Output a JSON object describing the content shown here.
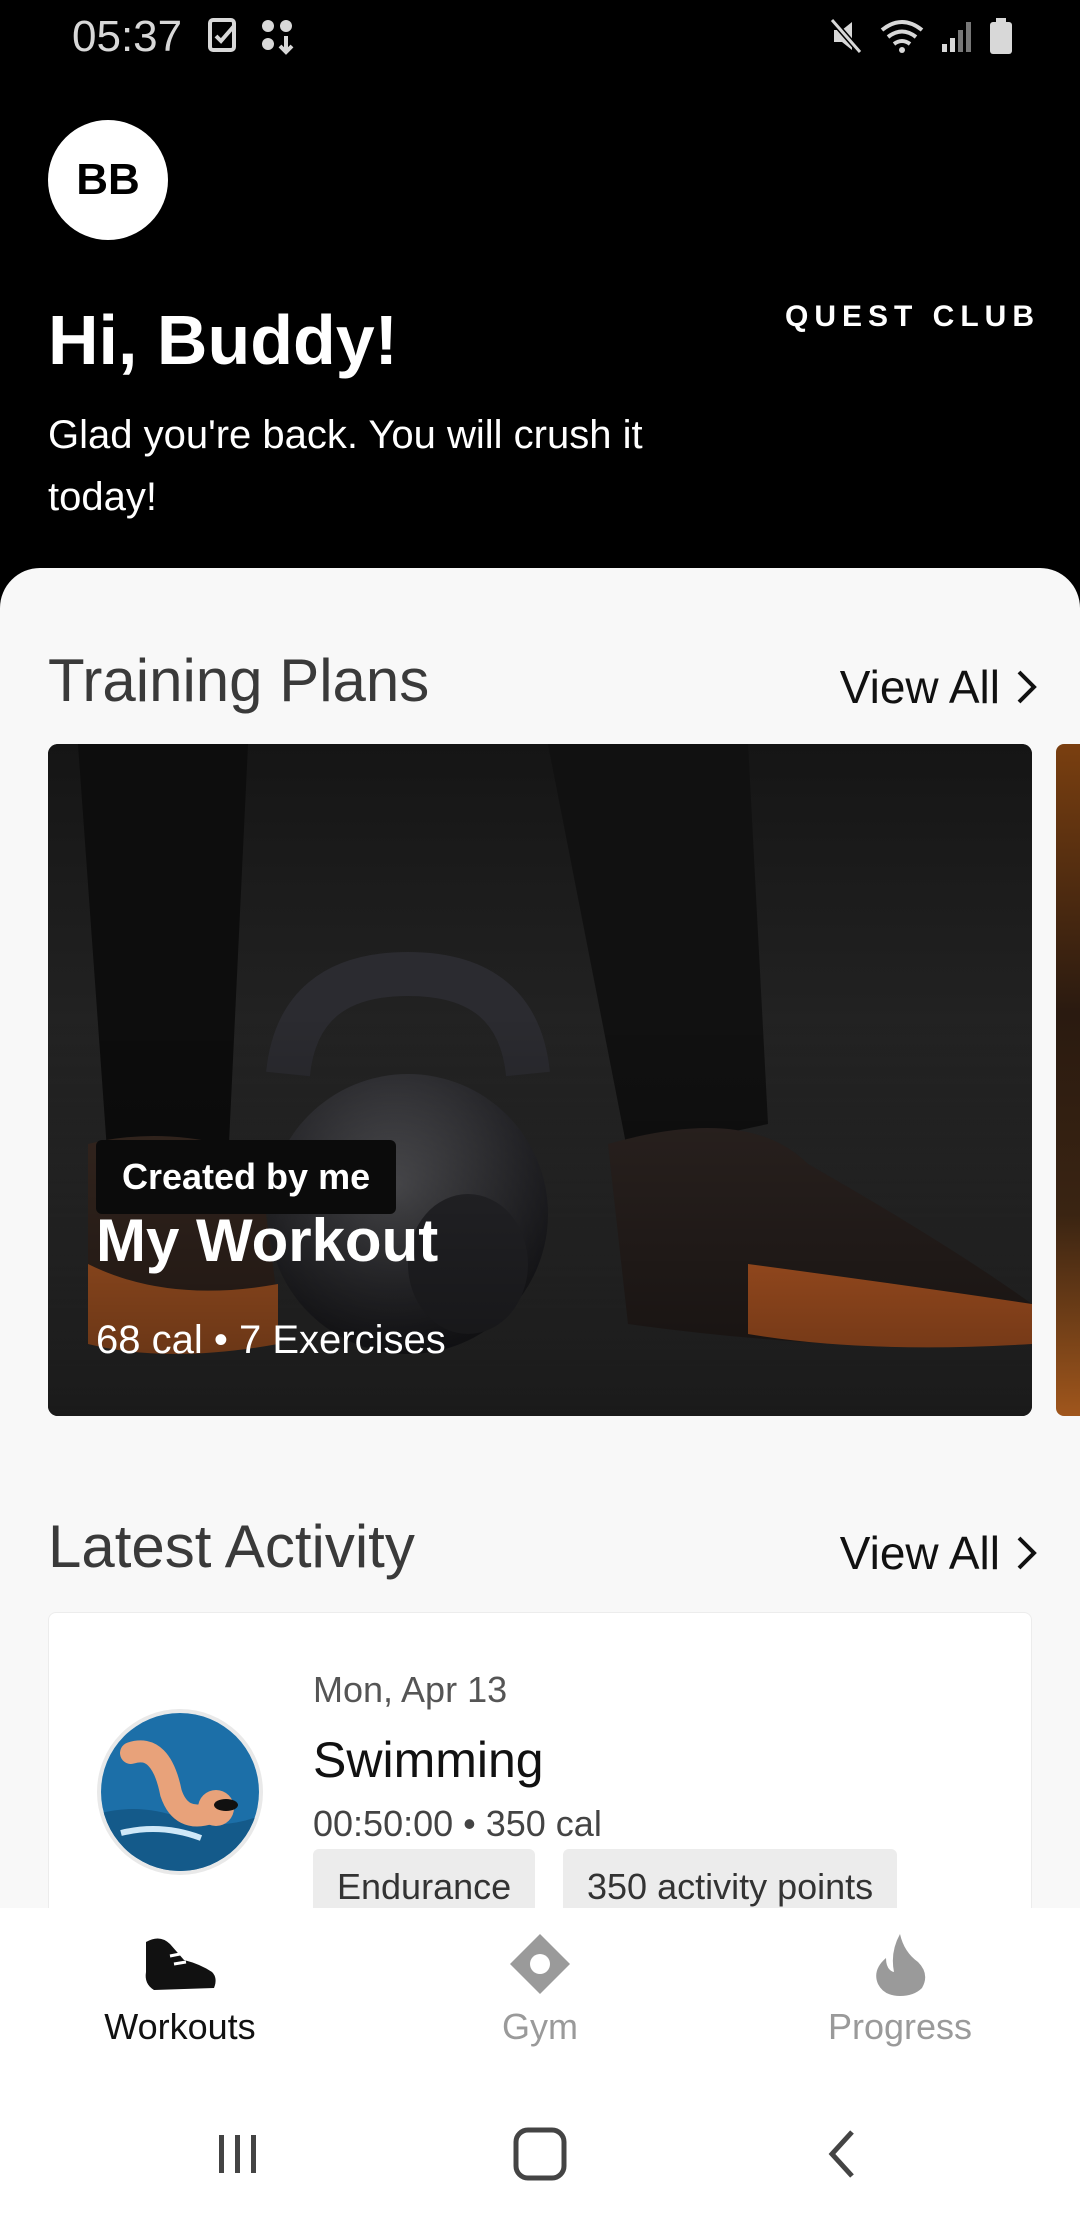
{
  "status_bar": {
    "time": "05:37",
    "left_icons": [
      "task-check-icon",
      "app-grid-icon"
    ],
    "right_icons": [
      "mute-icon",
      "wifi-icon",
      "signal-icon",
      "battery-icon"
    ]
  },
  "header": {
    "avatar_initials": "BB",
    "brand": "QUEST CLUB",
    "greeting": "Hi, Buddy!",
    "subtitle": "Glad you're back. You will crush it today!"
  },
  "training_plans": {
    "title": "Training Plans",
    "view_all": "View All",
    "cards": [
      {
        "badge": "Created by me",
        "title": "My Workout",
        "meta": "68 cal • 7 Exercises"
      }
    ]
  },
  "latest_activity": {
    "title": "Latest Activity",
    "view_all": "View All",
    "items": [
      {
        "date": "Mon, Apr 13",
        "name": "Swimming",
        "meta": "00:50:00 • 350 cal",
        "tags": [
          "Endurance",
          "350 activity points"
        ]
      }
    ]
  },
  "bottom_nav": {
    "items": [
      {
        "label": "Workouts",
        "icon": "sneaker-icon",
        "active": true
      },
      {
        "label": "Gym",
        "icon": "location-diamond-icon",
        "active": false
      },
      {
        "label": "Progress",
        "icon": "flame-icon",
        "active": false
      }
    ]
  },
  "system_nav": {
    "buttons": [
      "recent-apps-icon",
      "home-icon",
      "back-icon"
    ]
  },
  "colors": {
    "header_bg": "#000000",
    "sheet_bg": "#f8f8f8",
    "tag_bg": "#ececec",
    "active_nav": "#111111",
    "inactive_nav": "#9a9a9a"
  }
}
